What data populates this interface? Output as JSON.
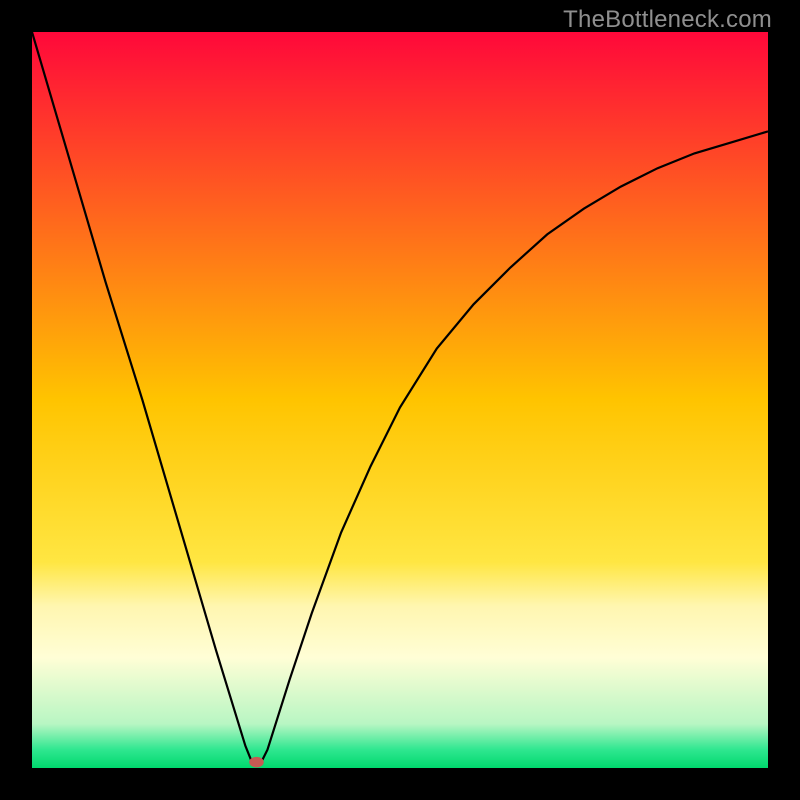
{
  "watermark": "TheBottleneck.com",
  "chart_data": {
    "type": "line",
    "title": "",
    "xlabel": "",
    "ylabel": "",
    "xlim": [
      0,
      100
    ],
    "ylim": [
      0,
      100
    ],
    "grid": false,
    "legend": false,
    "background_gradient": [
      {
        "stop": 0.0,
        "color": "#ff083a"
      },
      {
        "stop": 0.5,
        "color": "#ffc400"
      },
      {
        "stop": 0.72,
        "color": "#ffe642"
      },
      {
        "stop": 0.78,
        "color": "#fff6b0"
      },
      {
        "stop": 0.85,
        "color": "#fffed6"
      },
      {
        "stop": 0.94,
        "color": "#b8f6c3"
      },
      {
        "stop": 0.975,
        "color": "#2fe790"
      },
      {
        "stop": 1.0,
        "color": "#00d86d"
      }
    ],
    "series": [
      {
        "name": "bottleneck-curve",
        "stroke": "#000000",
        "x": [
          0,
          5,
          10,
          15,
          20,
          25,
          27,
          29,
          30,
          31,
          32,
          35,
          38,
          42,
          46,
          50,
          55,
          60,
          65,
          70,
          75,
          80,
          85,
          90,
          95,
          100
        ],
        "y": [
          100,
          83,
          66,
          50,
          33,
          16,
          9.5,
          3,
          0.5,
          0.5,
          2.5,
          12,
          21,
          32,
          41,
          49,
          57,
          63,
          68,
          72.5,
          76,
          79,
          81.5,
          83.5,
          85,
          86.5
        ]
      }
    ],
    "marker": {
      "x": 30.5,
      "y": 0.8,
      "r": 1.1,
      "color": "#c75a53"
    }
  }
}
